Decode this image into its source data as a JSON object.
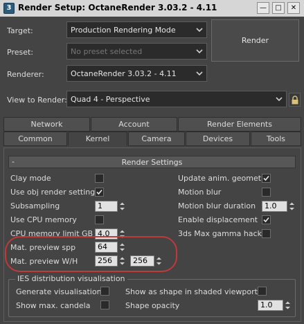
{
  "window": {
    "title": "Render Setup: OctaneRender 3.03.2 - 4.11",
    "app_icon": "3ds-max-icon",
    "controls": [
      "minimize-icon",
      "maximize-icon",
      "close-icon"
    ]
  },
  "form": {
    "target_label": "Target:",
    "target_value": "Production Rendering Mode",
    "preset_label": "Preset:",
    "preset_placeholder": "No preset selected",
    "renderer_label": "Renderer:",
    "renderer_value": "OctaneRender 3.03.2 - 4.11",
    "view_label": "View to Render:",
    "view_value": "Quad 4 - Perspective",
    "render_button": "Render"
  },
  "tabs": {
    "row1": [
      "Network",
      "Account",
      "Render Elements"
    ],
    "row2": [
      "Common",
      "Kernel",
      "Camera",
      "Devices",
      "Tools"
    ],
    "active": "Kernel"
  },
  "rollout": {
    "collapse_symbol": "-",
    "title": "Render Settings"
  },
  "settings": {
    "clay_mode": {
      "label": "Clay mode",
      "checked": false
    },
    "use_obj_render_settings": {
      "label": "Use obj render settings",
      "checked": true
    },
    "subsampling": {
      "label": "Subsampling",
      "value": "1"
    },
    "use_cpu_memory": {
      "label": "Use CPU memory",
      "checked": false
    },
    "cpu_memory_limit": {
      "label": "CPU memory limit GB",
      "value": "4.0"
    },
    "mat_preview_spp": {
      "label": "Mat. preview spp",
      "value": "64"
    },
    "mat_preview_wh": {
      "label": "Mat. preview W/H",
      "width": "256",
      "height": "256"
    },
    "update_anim_geometry": {
      "label": "Update anim. geometry",
      "checked": true
    },
    "motion_blur": {
      "label": "Motion blur",
      "checked": false
    },
    "motion_blur_duration": {
      "label": "Motion blur duration",
      "value": "1.0"
    },
    "enable_displacement": {
      "label": "Enable displacement",
      "checked": true
    },
    "max_gamma_hack": {
      "label": "3ds Max gamma hack",
      "checked": false
    }
  },
  "ies": {
    "group_title": "IES distribution visualisation",
    "generate": {
      "label": "Generate visualisation",
      "checked": false
    },
    "show_max_candela": {
      "label": "Show max. candela",
      "checked": false
    },
    "show_as_shape": {
      "label": "Show as shape in shaded viewports",
      "checked": false
    },
    "shape_opacity": {
      "label": "Shape opacity",
      "value": "1.0"
    }
  },
  "colors": {
    "background": "#444444",
    "titlebar": "#d6d6d6",
    "input_dark": "#2b2b2b",
    "spinner_field": "#e1e1e1",
    "annotation_red": "#c0393b"
  }
}
